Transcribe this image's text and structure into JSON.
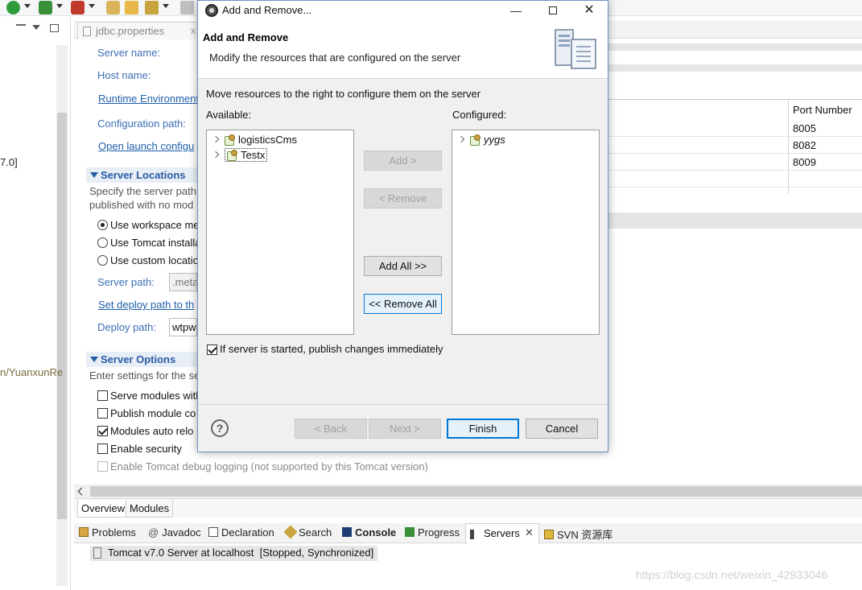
{
  "editor": {
    "tab_title": "jdbc.properties",
    "server_name_label": "Server name:",
    "host_name_label": "Host name:",
    "runtime_env_link": "Runtime Environment",
    "config_path_label": "Configuration path:",
    "open_launch_link": "Open launch configu",
    "server_locations_title": "Server Locations",
    "server_locations_desc1": "Specify the server path",
    "server_locations_desc2": "published with no mod",
    "radio_workspace": "Use workspace me",
    "radio_tomcat": "Use Tomcat installa",
    "radio_custom": "Use custom locatio",
    "server_path_label": "Server path:",
    "server_path_value": ".meta",
    "set_deploy_link": "Set deploy path to th",
    "deploy_path_label": "Deploy path:",
    "deploy_path_value": "wtpw",
    "server_options_title": "Server Options",
    "server_options_desc": "Enter settings for the se",
    "opt_serve_modules": "Serve modules with",
    "opt_publish_module": "Publish module co",
    "opt_auto_reload": "Modules auto relo",
    "opt_enable_security": "Enable security",
    "opt_debug_logging": "Enable Tomcat debug logging (not supported by this Tomcat version)",
    "port_header": "Port Number",
    "ports": [
      "8005",
      "8082",
      "8009"
    ]
  },
  "left_view": {
    "fragment_version": "7.0]",
    "fragment_path": "n/YuanxunRe"
  },
  "page_tabs": {
    "overview": "Overview",
    "modules": "Modules"
  },
  "views": {
    "problems": "Problems",
    "javadoc": "Javadoc",
    "declaration": "Declaration",
    "search": "Search",
    "console": "Console",
    "progress": "Progress",
    "servers": "Servers",
    "svn": "SVN 资源库",
    "server_entry": "Tomcat v7.0 Server at localhost  [Stopped, Synchronized]"
  },
  "watermark": "https://blog.csdn.net/weixin_42933046",
  "dialog": {
    "title": "Add and Remove...",
    "banner_title": "Add and Remove",
    "banner_message": "Modify the resources that are configured on the server",
    "instruction": "Move resources to the right to configure them on the server",
    "available_label": "Available:",
    "configured_label": "Configured:",
    "available_items": [
      "logisticsCms",
      "Testx"
    ],
    "configured_items": [
      "yygs"
    ],
    "add_button": "Add >",
    "remove_button": "< Remove",
    "add_all_button": "Add All >>",
    "remove_all_button": "<< Remove All",
    "publish_checkbox": "If server is started, publish changes immediately",
    "back_button": "< Back",
    "next_button": "Next >",
    "finish_button": "Finish",
    "cancel_button": "Cancel",
    "help_symbol": "?"
  },
  "colors": {
    "link_blue": "#1f5fa9",
    "section_blue": "#275ca3",
    "dialog_border": "#6e93c2",
    "default_button": "#0078d7"
  }
}
